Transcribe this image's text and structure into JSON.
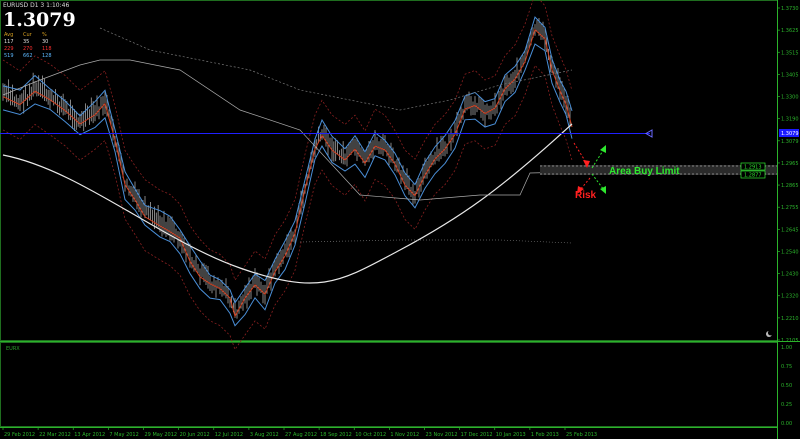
{
  "header": {
    "symbol": "EURUSD D1 3 1:10:46",
    "price": "1.3079"
  },
  "stats": {
    "headers": [
      "Avg",
      "Cur",
      "%"
    ],
    "rows": [
      {
        "a": "117",
        "b": "35",
        "c": "30",
        "color": "#e0e0e0"
      },
      {
        "a": "229",
        "b": "270",
        "c": "118",
        "color": "#ff3030"
      },
      {
        "a": "519",
        "b": "662",
        "c": "128",
        "color": "#5db8ff"
      }
    ]
  },
  "indicator_label": "EURX",
  "annotations": {
    "buy_label": "Area Buy Limit",
    "risk_label": "Risk"
  },
  "price_axis": {
    "labels": [
      "1.3730",
      "1.3625",
      "1.3515",
      "1.3405",
      "1.3300",
      "1.3190",
      "1.3079",
      "1.2965",
      "1.2865",
      "1.2755",
      "1.2645",
      "1.2540",
      "1.2430",
      "1.2320",
      "1.2210",
      "1.2105"
    ],
    "current_tag": "1.3079",
    "tag_green_1": "1.2913",
    "tag_green_2": "1.2877",
    "colors": {
      "axis": "#2bb32b",
      "current": "#1a1aff",
      "bg": "#000000"
    }
  },
  "indicator_axis": {
    "labels": [
      "1.00",
      "0.75",
      "0.50",
      "0.25",
      "0.00"
    ]
  },
  "time_axis": {
    "labels": [
      "29 Feb 2012",
      "22 Mar 2012",
      "13 Apr 2012",
      "7 May 2012",
      "29 May 2012",
      "20 Jun 2012",
      "12 Jul 2012",
      "3 Aug 2012",
      "27 Aug 2012",
      "18 Sep 2012",
      "10 Oct 2012",
      "1 Nov 2012",
      "23 Nov 2012",
      "17 Dec 2012",
      "10 Jan 2013",
      "1 Feb 2013",
      "25 Feb 2013"
    ]
  }
}
